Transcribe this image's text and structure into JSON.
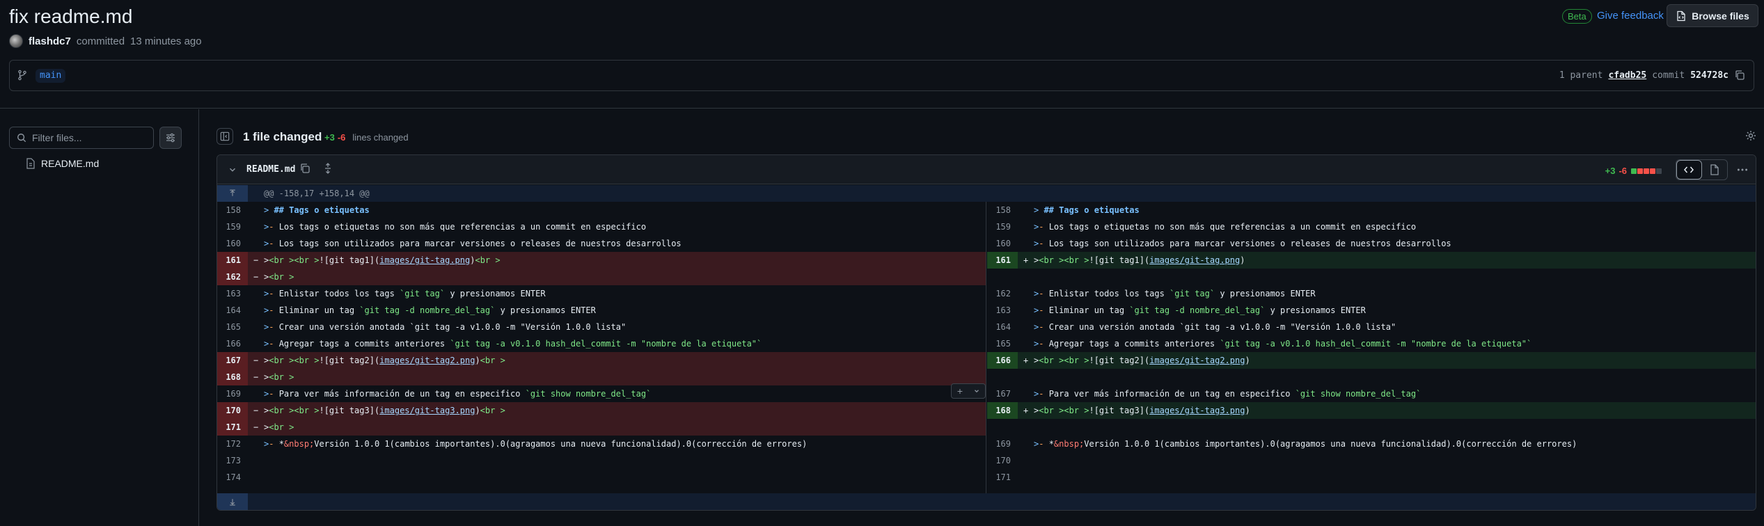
{
  "commit": {
    "title": "fix readme.md",
    "author": "flashdc7",
    "action": "committed",
    "time": "13 minutes ago",
    "branch": "main",
    "parent_label": "1 parent",
    "parent_sha": "cfadb25",
    "commit_label": "commit",
    "commit_sha": "524728c"
  },
  "header_actions": {
    "beta": "Beta",
    "feedback": "Give feedback",
    "browse": "Browse files"
  },
  "sidebar": {
    "filter_placeholder": "Filter files...",
    "files": [
      "README.md"
    ]
  },
  "summary": {
    "files_changed": "1 file changed",
    "additions": "+3",
    "deletions": "-6",
    "lines_changed": "lines changed"
  },
  "diff": {
    "file": "README.md",
    "additions": "+3",
    "deletions": "-6",
    "hunk_header": "@@ -158,17 +158,14 @@",
    "left": [
      {
        "ln": "158",
        "type": "ctx",
        "code": "> ## Tags o etiquetas"
      },
      {
        "ln": "159",
        "type": "ctx",
        "code": ">- Los tags o etiquetas no son más que referencias a un commit en especifico"
      },
      {
        "ln": "160",
        "type": "ctx",
        "code": ">- Los tags son utilizados para marcar versiones o releases de nuestros desarrollos"
      },
      {
        "ln": "161",
        "type": "del",
        "code": "><br ><br >![git tag1](images/git-tag.png)<br >"
      },
      {
        "ln": "162",
        "type": "del",
        "code": "><br >"
      },
      {
        "ln": "163",
        "type": "ctx",
        "code": ">- Enlistar todos los tags `git tag` y presionamos ENTER"
      },
      {
        "ln": "164",
        "type": "ctx",
        "code": ">- Eliminar un tag `git tag -d nombre_del_tag` y presionamos ENTER"
      },
      {
        "ln": "165",
        "type": "ctx",
        "code": ">- Crear una versión anotada `git tag -a v1.0.0 -m \"Versión 1.0.0 lista\""
      },
      {
        "ln": "166",
        "type": "ctx",
        "code": ">- Agregar tags a commits anteriores `git tag -a v0.1.0 hash_del_commit -m \"nombre de la etiqueta\"`"
      },
      {
        "ln": "167",
        "type": "del",
        "code": "><br ><br >![git tag2](images/git-tag2.png)<br >"
      },
      {
        "ln": "168",
        "type": "del",
        "code": "><br >"
      },
      {
        "ln": "169",
        "type": "ctx",
        "code": ">- Para ver más información de un tag en especifico `git show nombre_del_tag`"
      },
      {
        "ln": "170",
        "type": "del",
        "code": "><br ><br >![git tag3](images/git-tag3.png)<br >"
      },
      {
        "ln": "171",
        "type": "del",
        "code": "><br >"
      },
      {
        "ln": "172",
        "type": "ctx",
        "code": ">- *&nbsp;Versión 1.0.0 1(cambios importantes).0(agragamos una nueva funcionalidad).0(corrección de errores)"
      },
      {
        "ln": "173",
        "type": "ctx",
        "code": ""
      },
      {
        "ln": "174",
        "type": "ctx",
        "code": ""
      }
    ],
    "right": [
      {
        "ln": "158",
        "type": "ctx",
        "code": "> ## Tags o etiquetas"
      },
      {
        "ln": "159",
        "type": "ctx",
        "code": ">- Los tags o etiquetas no son más que referencias a un commit en especifico"
      },
      {
        "ln": "160",
        "type": "ctx",
        "code": ">- Los tags son utilizados para marcar versiones o releases de nuestros desarrollos"
      },
      {
        "ln": "161",
        "type": "add",
        "code": "><br ><br >![git tag1](images/git-tag.png)"
      },
      {
        "ln": "",
        "type": "empty",
        "code": ""
      },
      {
        "ln": "162",
        "type": "ctx",
        "code": ">- Enlistar todos los tags `git tag` y presionamos ENTER"
      },
      {
        "ln": "163",
        "type": "ctx",
        "code": ">- Eliminar un tag `git tag -d nombre_del_tag` y presionamos ENTER"
      },
      {
        "ln": "164",
        "type": "ctx",
        "code": ">- Crear una versión anotada `git tag -a v1.0.0 -m \"Versión 1.0.0 lista\""
      },
      {
        "ln": "165",
        "type": "ctx",
        "code": ">- Agregar tags a commits anteriores `git tag -a v0.1.0 hash_del_commit -m \"nombre de la etiqueta\"`"
      },
      {
        "ln": "166",
        "type": "add",
        "code": "><br ><br >![git tag2](images/git-tag2.png)"
      },
      {
        "ln": "",
        "type": "empty",
        "code": ""
      },
      {
        "ln": "167",
        "type": "ctx",
        "code": ">- Para ver más información de un tag en especifico `git show nombre_del_tag`"
      },
      {
        "ln": "168",
        "type": "add",
        "code": "><br ><br >![git tag3](images/git-tag3.png)"
      },
      {
        "ln": "",
        "type": "empty",
        "code": ""
      },
      {
        "ln": "169",
        "type": "ctx",
        "code": ">- *&nbsp;Versión 1.0.0 1(cambios importantes).0(agragamos una nueva funcionalidad).0(corrección de errores)"
      },
      {
        "ln": "170",
        "type": "ctx",
        "code": ""
      },
      {
        "ln": "171",
        "type": "ctx",
        "code": ""
      }
    ]
  },
  "colors": {
    "bg": "#0d1117",
    "accent": "#4493f8",
    "added": "#3fb950",
    "deleted": "#f85149"
  }
}
